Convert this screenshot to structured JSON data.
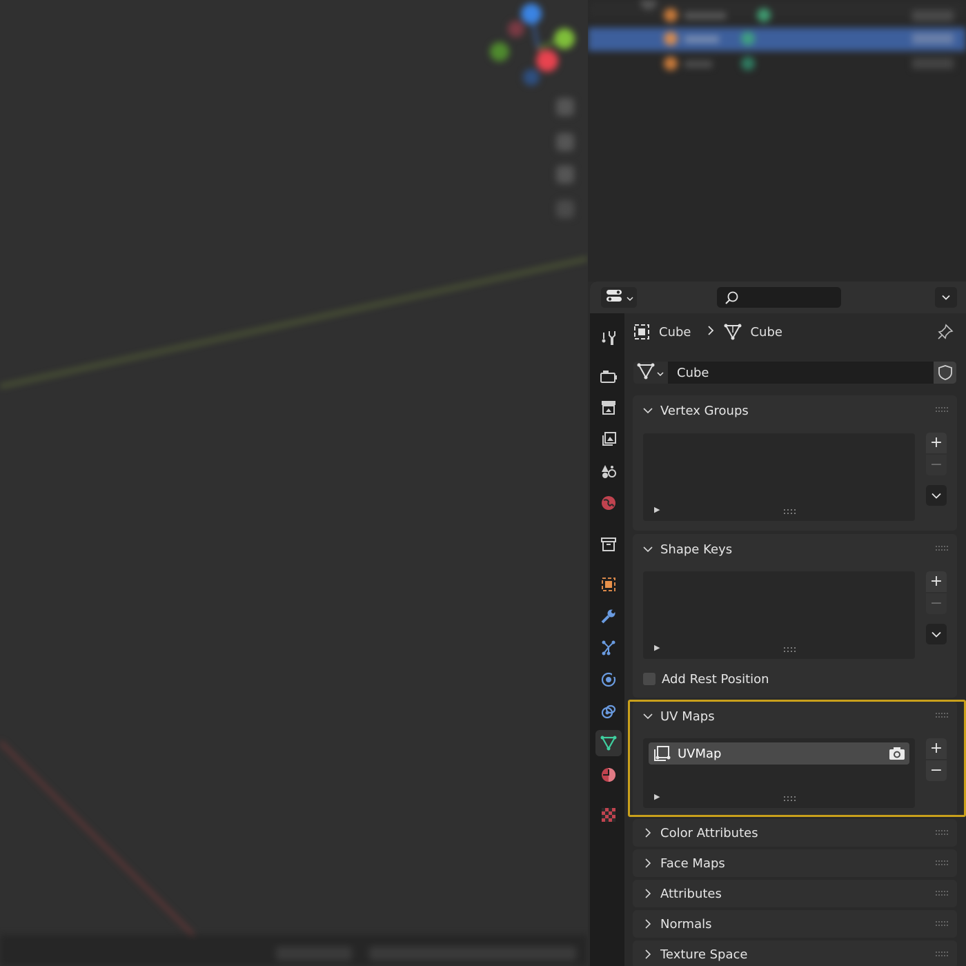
{
  "properties": {
    "breadcrumb": [
      {
        "label": "Cube",
        "icon": "object-icon"
      },
      {
        "label": "Cube",
        "icon": "mesh-data-icon"
      }
    ],
    "datablock_name": "Cube",
    "tabs": [
      "tool-tab-icon",
      "render-tab-icon",
      "output-tab-icon",
      "view-layer-tab-icon",
      "scene-tab-icon",
      "world-tab-icon",
      "collection-tab-icon",
      "object-tab-icon",
      "modifiers-tab-icon",
      "particles-tab-icon",
      "physics-tab-icon",
      "constraints-tab-icon",
      "data-tab-icon",
      "material-tab-icon",
      "texture-tab-icon"
    ],
    "active_tab": "data-tab-icon",
    "panels": {
      "vertex_groups": "Vertex Groups",
      "shape_keys": "Shape Keys",
      "add_rest_position": "Add Rest Position",
      "uv_maps": "UV Maps",
      "uv_map_item": "UVMap",
      "color_attributes": "Color Attributes",
      "face_maps": "Face Maps",
      "attributes": "Attributes",
      "normals": "Normals",
      "texture_space": "Texture Space"
    },
    "list_expander_glyph": "▶",
    "add_glyph": "+",
    "remove_glyph": "−"
  },
  "colors": {
    "highlight_outline": "#c9a01b",
    "active_row": "#4772b3",
    "object_orange": "#e8914a",
    "data_green": "#3fd0a0"
  }
}
